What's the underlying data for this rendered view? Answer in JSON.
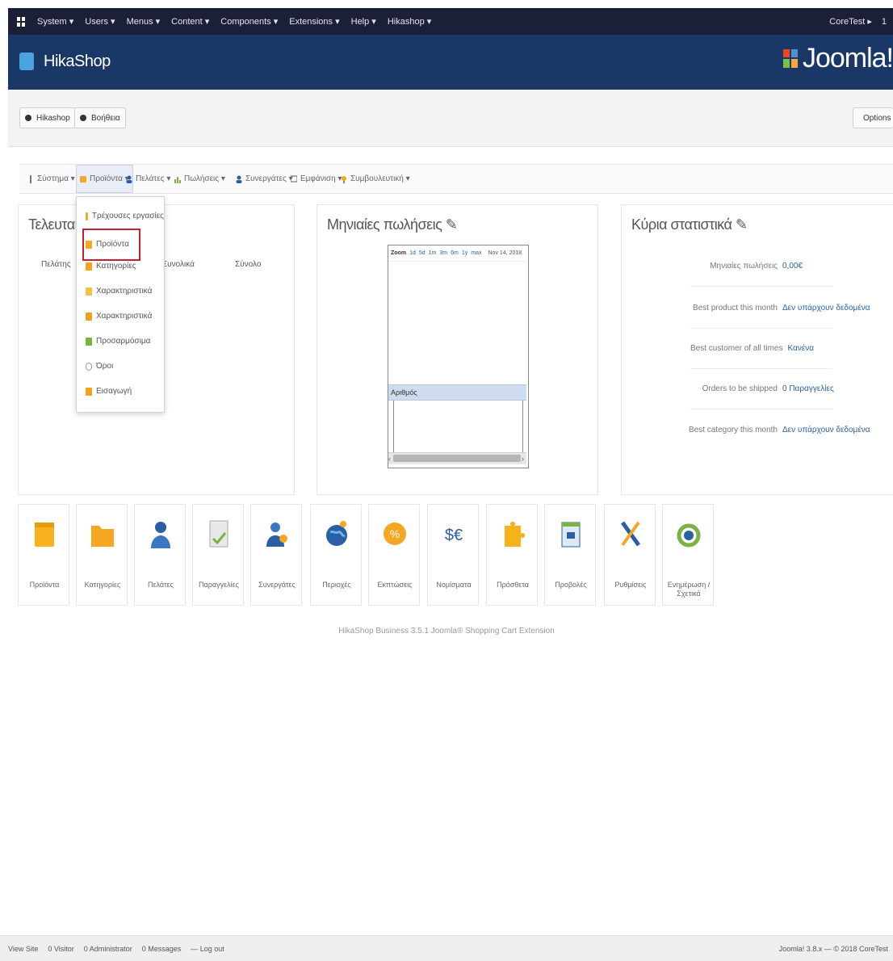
{
  "topbar": {
    "menu": [
      "System ▾",
      "Users ▾",
      "Menus ▾",
      "Content ▾",
      "Components ▾",
      "Extensions ▾",
      "Help ▾",
      "Hikashop ▾"
    ],
    "right": [
      "CoreTest ▸",
      "1"
    ]
  },
  "header": {
    "title": "HikaShop",
    "joomla_word": "Joomla!"
  },
  "toolbar": {
    "left_buttons": [
      "Hikashop",
      "Βοήθεια"
    ],
    "right_button": "Options"
  },
  "subnav": {
    "items": [
      "Σύστημα ▾",
      "Προϊόντα ▾",
      "Πελάτες ▾",
      "Πωλήσεις ▾",
      "Συνεργάτες ▾",
      "Εμφάνιση ▾",
      "Συμβουλευτική ▾"
    ]
  },
  "dropdown": {
    "items": [
      "Τρέχουσες εργασίες",
      "Προϊόντα",
      "Κατηγορίες",
      "Χαρακτηριστικά",
      "Χαρακτηριστικά",
      "Προσαρμόσιμα",
      "Όροι",
      "Εισαγωγή"
    ],
    "highlighted": "Προϊόντα"
  },
  "panels": {
    "last_orders": {
      "title": "Τελευταίες 7",
      "columns": [
        "Πελάτης",
        "Συνολικά",
        "Σύνολο"
      ]
    },
    "sales": {
      "title": "Μηνιαίες πωλήσεις ✎",
      "chart_top": [
        "Zoom",
        "1d",
        "5d",
        "1m",
        "3m",
        "6m",
        "1y",
        "max",
        "Nov 14, 2018"
      ],
      "chart_label": "Αριθμός"
    },
    "main_stats": {
      "title": "Κύρια στατιστικά ✎",
      "rows": [
        {
          "label": "Μηνιαίες πωλήσεις",
          "value": "0,00€"
        },
        {
          "label": "Best product this month",
          "value": "Δεν υπάρχουν δεδομένα"
        },
        {
          "label": "Best customer of all times",
          "value": "Κανένα"
        },
        {
          "label": "Orders to be shipped",
          "value": "0 Παραγγελίες"
        },
        {
          "label": "Best category this month",
          "value": "Δεν υπάρχουν δεδομένα"
        }
      ]
    }
  },
  "icons": [
    {
      "name": "products",
      "label": "Προϊόντα"
    },
    {
      "name": "categories",
      "label": "Κατηγορίες"
    },
    {
      "name": "customers",
      "label": "Πελάτες"
    },
    {
      "name": "orders",
      "label": "Παραγγελίες"
    },
    {
      "name": "affiliates",
      "label": "Συνεργάτες"
    },
    {
      "name": "zones",
      "label": "Περιοχές"
    },
    {
      "name": "discounts",
      "label": "Εκπτώσεις"
    },
    {
      "name": "currencies",
      "label": "Νομίσματα"
    },
    {
      "name": "plugins",
      "label": "Πρόσθετα"
    },
    {
      "name": "views",
      "label": "Προβολές"
    },
    {
      "name": "configuration",
      "label": "Ρυθμίσεις"
    },
    {
      "name": "updates",
      "label": "Ενημέρωση / Σχετικά"
    }
  ],
  "footer_copy": "HikaShop Business 3.5.1 Joomla® Shopping Cart Extension",
  "statusbar": {
    "items": [
      "View Site",
      "0 Visitor",
      "0 Administrator",
      "0 Messages",
      "— Log out"
    ],
    "version": "Joomla! 3.8.x — © 2018 CoreTest"
  },
  "colors": {
    "topbar_bg": "#1c1f38",
    "header_bg": "#1a3867",
    "highlight_border": "#c81e2d",
    "link": "#2a5fa6"
  }
}
